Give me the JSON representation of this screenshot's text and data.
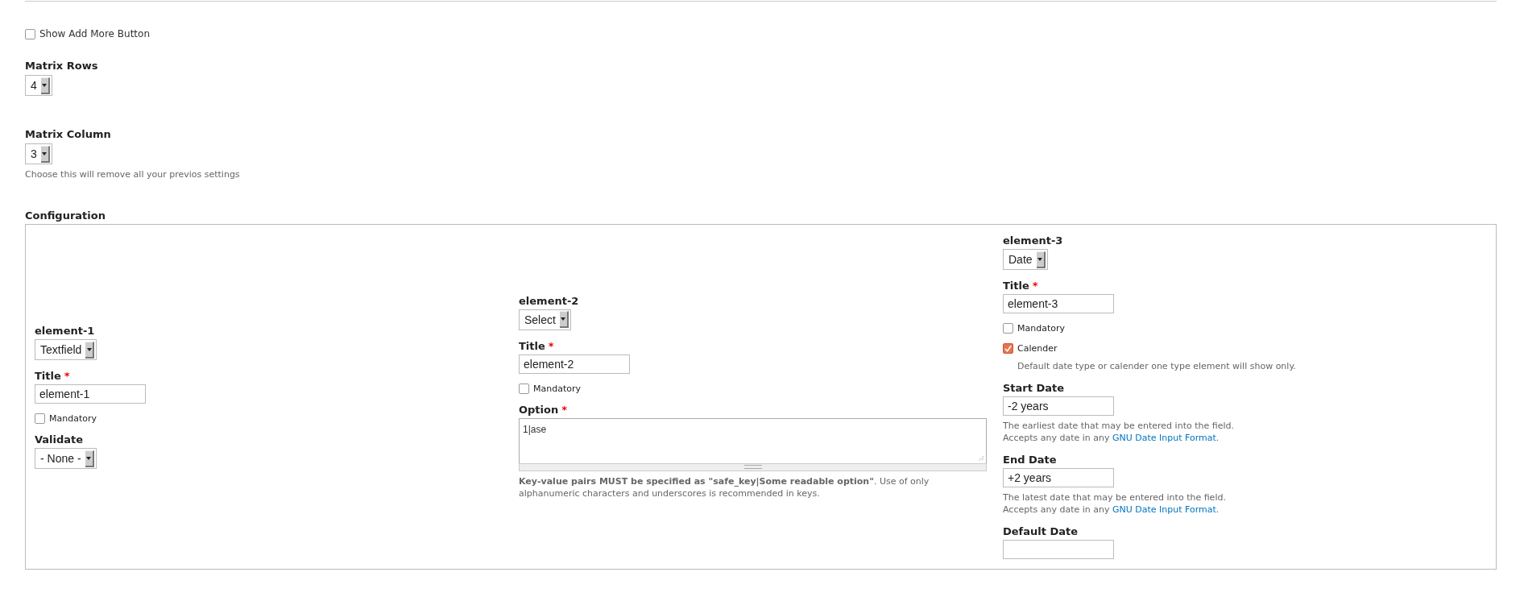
{
  "show_add_more": {
    "label": "Show Add More Button",
    "checked": false
  },
  "matrix_rows": {
    "label": "Matrix Rows",
    "value": "4"
  },
  "matrix_column": {
    "label": "Matrix Column",
    "value": "3",
    "description": "Choose this will remove all your previos settings"
  },
  "configuration": {
    "title": "Configuration",
    "columns": [
      {
        "fields": [
          {
            "kind": "select",
            "label": "element-1",
            "value": "Textfield"
          },
          {
            "kind": "text",
            "label": "Title",
            "required_mark": "*",
            "value": "element-1"
          },
          {
            "kind": "checkbox",
            "label": "Mandatory",
            "checked": false
          },
          {
            "kind": "select",
            "label": "Validate",
            "value": "- None -"
          }
        ]
      },
      {
        "fields": [
          {
            "kind": "select",
            "label": "element-2",
            "value": "Select"
          },
          {
            "kind": "text",
            "label": "Title",
            "required_mark": "*",
            "value": "element-2"
          },
          {
            "kind": "checkbox",
            "label": "Mandatory",
            "checked": false
          },
          {
            "kind": "textarea",
            "label": "Option",
            "required_mark": "*",
            "value": "1|ase",
            "description": "**Key-value pairs MUST be specified as \"safe_key|Some readable option\"**. Use of only alphanumeric characters and underscores is recommended in keys."
          }
        ]
      },
      {
        "fields": [
          {
            "kind": "select",
            "label": "element-3",
            "value": "Date"
          },
          {
            "kind": "text",
            "label": "Title",
            "required_mark": "*",
            "value": "element-3"
          },
          {
            "kind": "checkbox",
            "label": "Mandatory",
            "checked": false
          },
          {
            "kind": "checkbox",
            "label": "Calender",
            "checked": true,
            "description": "Default date type or calender one type element will show only."
          },
          {
            "kind": "text",
            "label": "Start Date",
            "value": "-2 years",
            "description": "The earliest date that may be entered into the field.",
            "note": "Accepts any date in any ",
            "link": "GNU Date Input Format",
            "note_end": "."
          },
          {
            "kind": "text",
            "label": "End Date",
            "value": "+2 years",
            "description": "The latest date that may be entered into the field.",
            "note": "Accepts any date in any ",
            "link": "GNU Date Input Format",
            "note_end": "."
          },
          {
            "kind": "text",
            "label": "Default Date"
          }
        ]
      }
    ]
  }
}
